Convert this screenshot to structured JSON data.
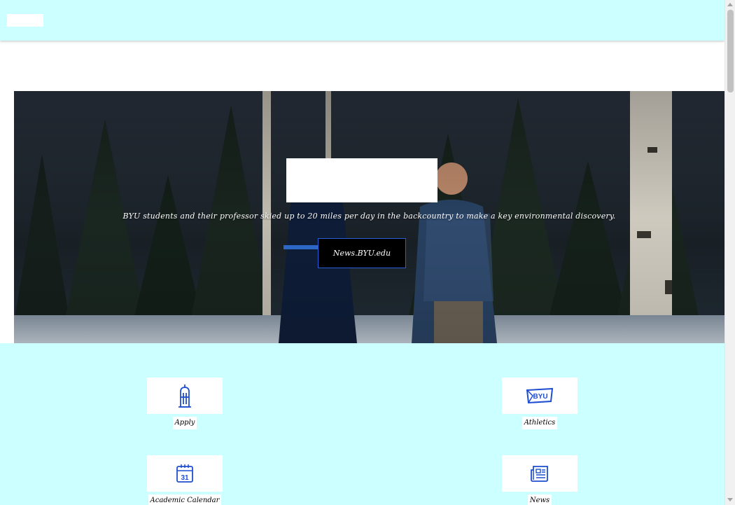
{
  "hero": {
    "caption": "BYU students and their professor skied up to 20 miles per day in the backcountry to make a key environmental discovery.",
    "button_label": "News.BYU.edu"
  },
  "quick_links": [
    {
      "label": "Apply",
      "icon": "building-icon"
    },
    {
      "label": "Athletics",
      "icon": "byu-logo-icon"
    },
    {
      "label": "Academic Calendar",
      "icon": "calendar-icon",
      "icon_text": "31"
    },
    {
      "label": "News",
      "icon": "newspaper-icon"
    }
  ],
  "colors": {
    "header_bg": "#ccffff",
    "links_bg": "#ccffff",
    "icon_blue": "#1f4fd0",
    "button_border": "#2a5fd9"
  }
}
